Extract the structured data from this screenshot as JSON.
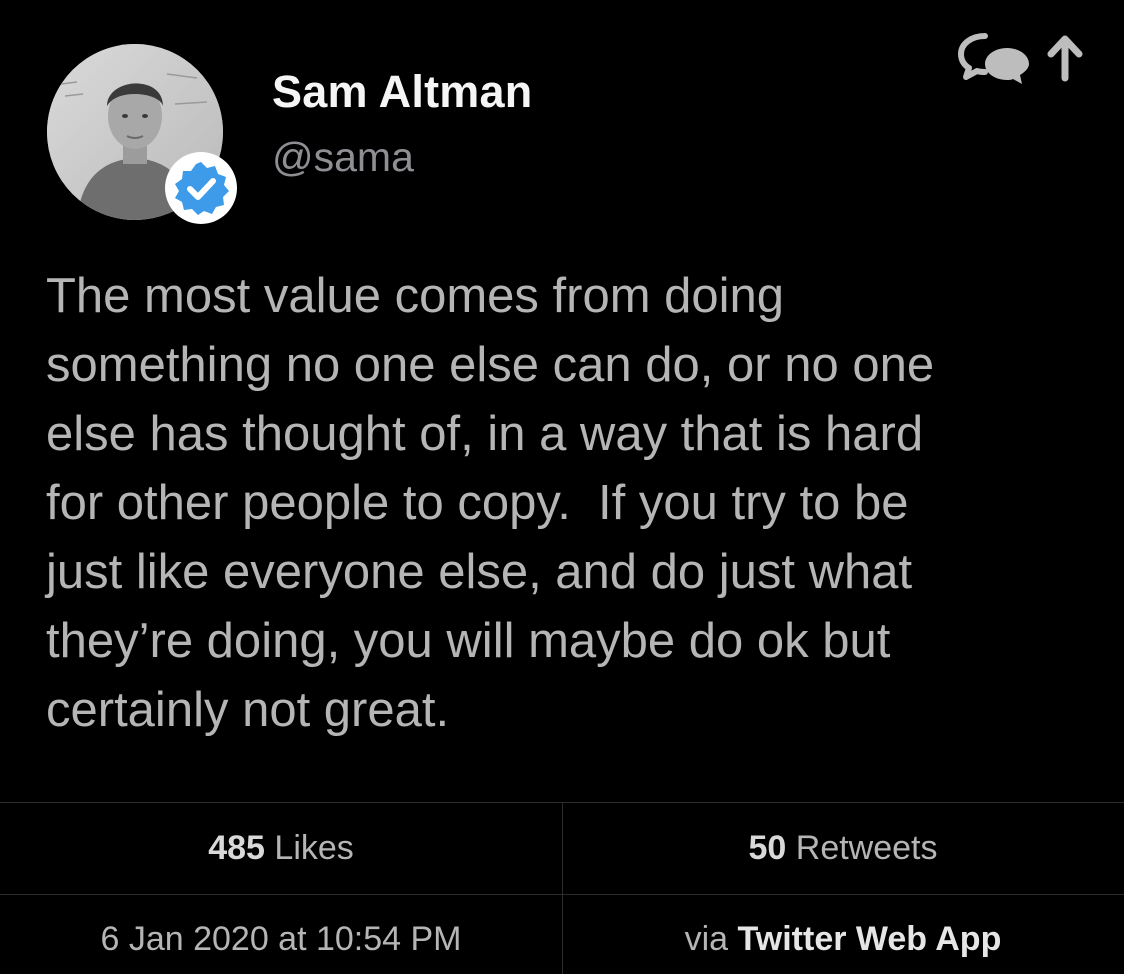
{
  "author": {
    "name": "Sam Altman",
    "handle": "@sama",
    "verified": true
  },
  "tweet": {
    "text": "The most value comes from doing\nsomething no one else can do, or no one\nelse has thought of, in a way that is hard\nfor other people to copy.  If you try to be\njust like everyone else, and do just what\nthey’re doing, you will maybe do ok but\ncertainly not great."
  },
  "stats": {
    "likes_count": "485",
    "likes_label": "Likes",
    "retweets_count": "50",
    "retweets_label": "Retweets"
  },
  "meta": {
    "timestamp": "6 Jan 2020 at 10:54 PM",
    "via_label": "via",
    "source": "Twitter Web App"
  },
  "icons": {
    "header": [
      "reply-icon",
      "share-icon"
    ],
    "badge": "verified-check-icon"
  },
  "colors": {
    "background": "#000000",
    "name": "#f5f5f5",
    "handle": "#8e8e93",
    "body_text": "#b5b5b5",
    "divider": "#2c2c2e",
    "verified_blue": "#3d9be9"
  }
}
